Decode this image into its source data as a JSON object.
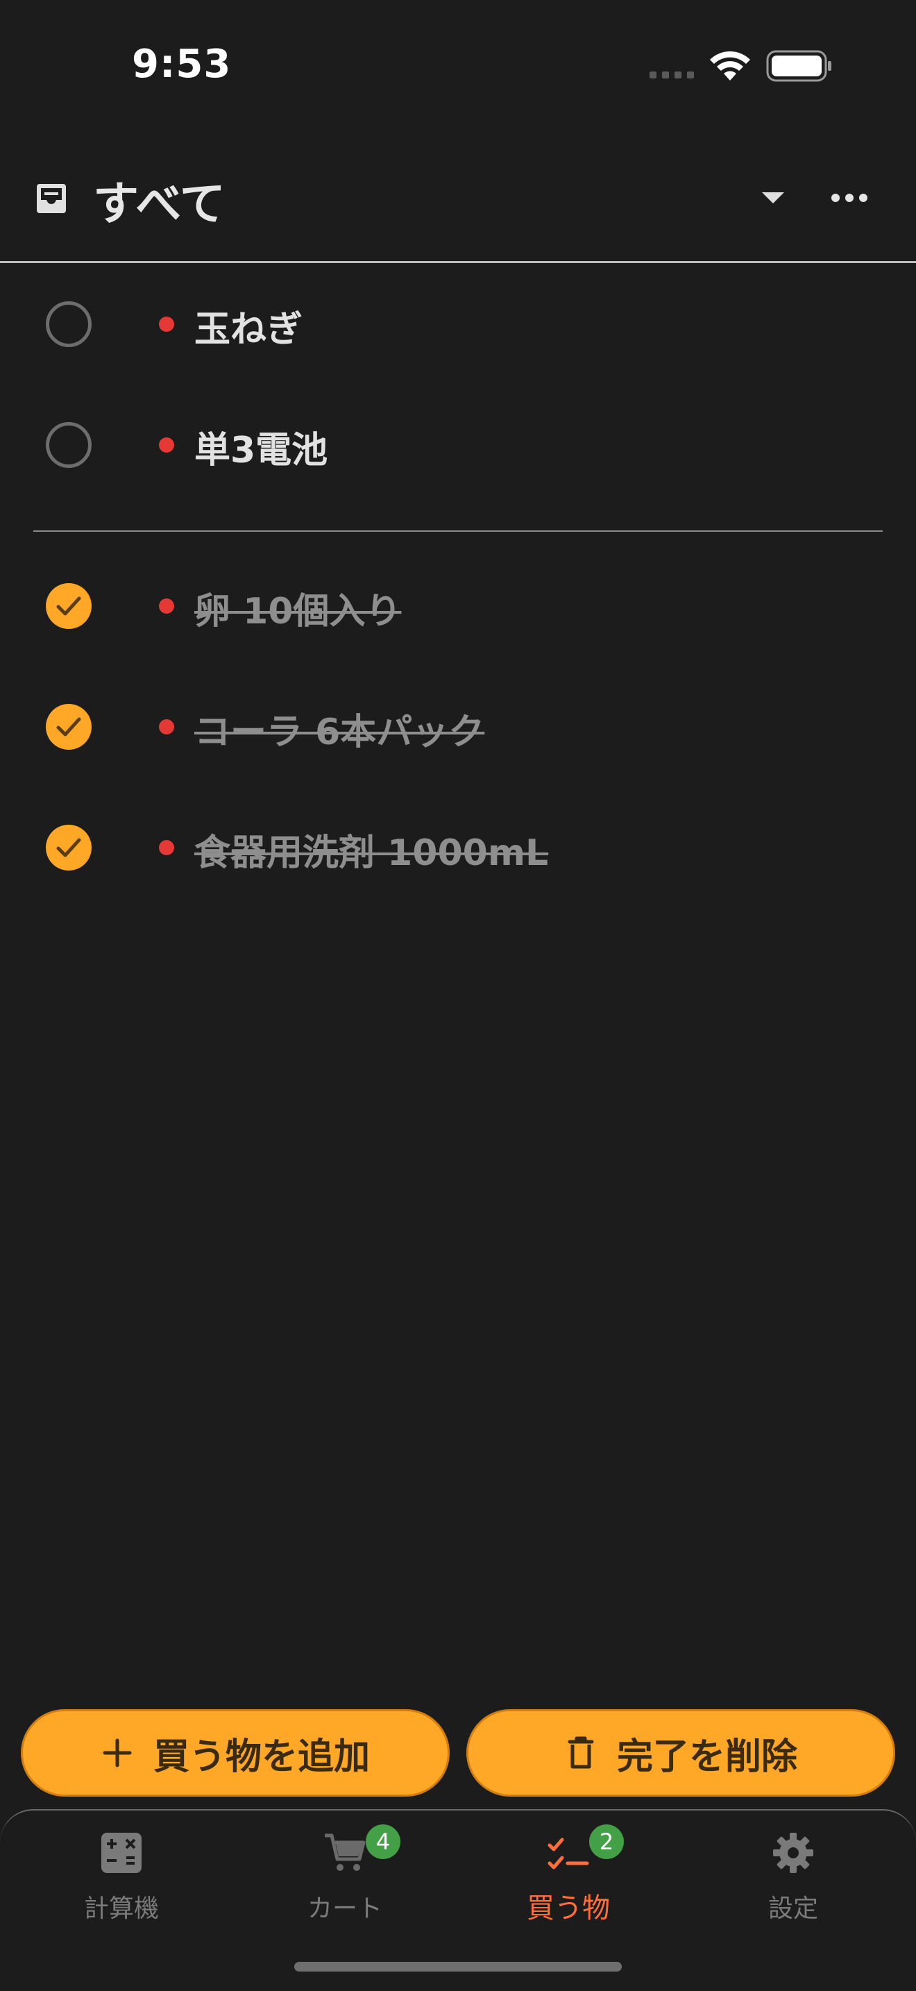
{
  "status_bar": {
    "time": "9:53"
  },
  "header": {
    "title": "すべて"
  },
  "items": [
    {
      "label": "玉ねぎ",
      "done": false
    },
    {
      "label": "単3電池",
      "done": false
    },
    {
      "label": "卵 10個入り",
      "done": true
    },
    {
      "label": "コーラ 6本パック",
      "done": true
    },
    {
      "label": "食器用洗剤 1000mL",
      "done": true
    }
  ],
  "actions": {
    "add_label": "買う物を追加",
    "clear_label": "完了を削除"
  },
  "tabs": [
    {
      "label": "計算機",
      "icon": "calculator-icon",
      "badge": ""
    },
    {
      "label": "カート",
      "icon": "cart-icon",
      "badge": "4"
    },
    {
      "label": "買う物",
      "icon": "checklist-icon",
      "badge": "2",
      "active": true
    },
    {
      "label": "設定",
      "icon": "gear-icon",
      "badge": ""
    }
  ],
  "colors": {
    "background": "#1c1c1c",
    "accent": "#ffa726",
    "active_tab": "#ff6f3c",
    "badge": "#43a047",
    "dot": "#e53935"
  }
}
